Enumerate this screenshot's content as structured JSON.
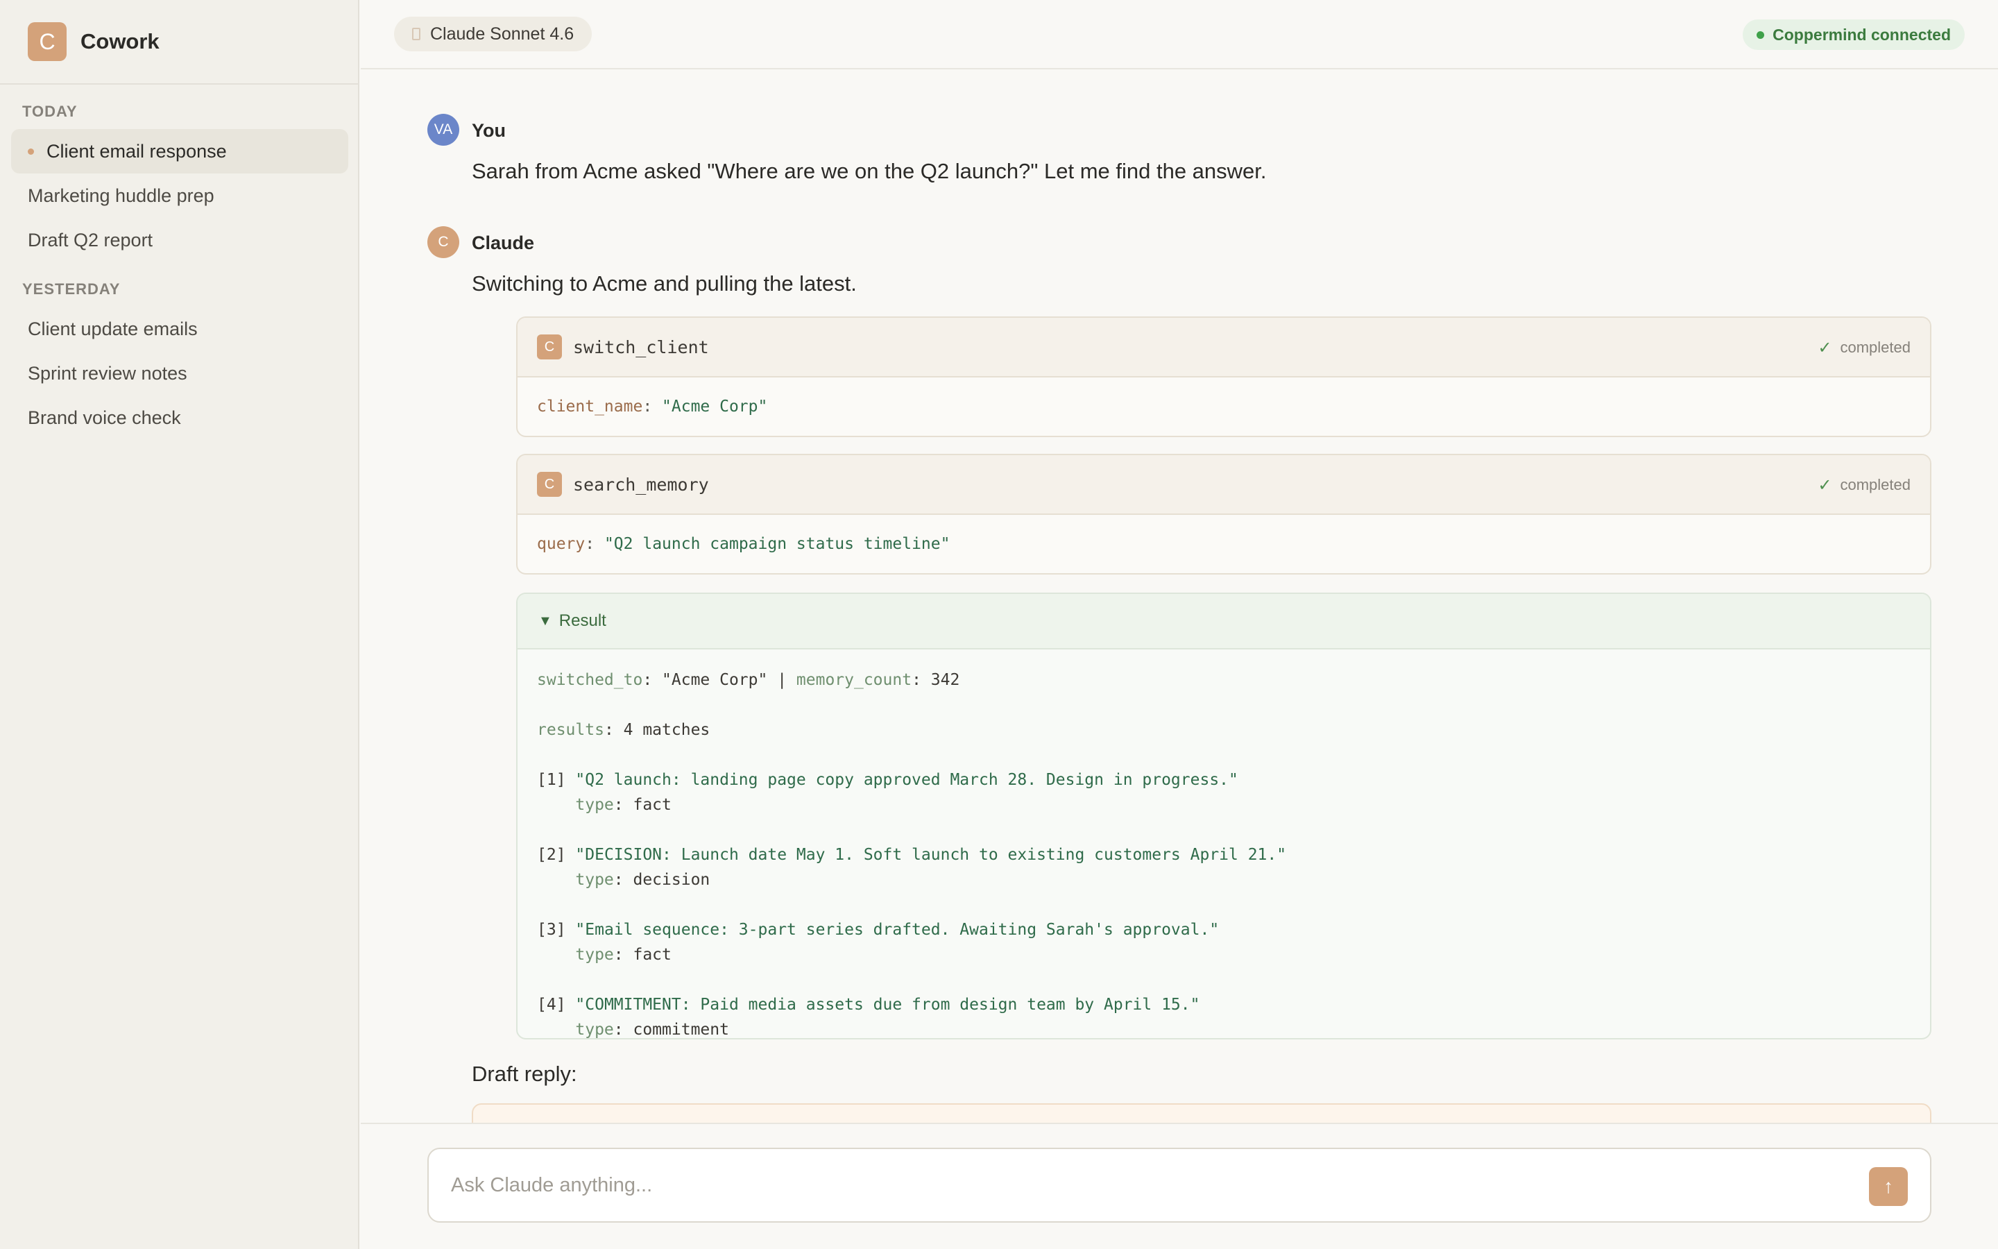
{
  "app": {
    "logo_letter": "C",
    "name": "Cowork"
  },
  "sidebar": {
    "today_label": "TODAY",
    "yesterday_label": "YESTERDAY",
    "today": [
      {
        "label": "Client email response",
        "active": true
      },
      {
        "label": "Marketing huddle prep"
      },
      {
        "label": "Draft Q2 report"
      }
    ],
    "yesterday": [
      {
        "label": "Client update emails"
      },
      {
        "label": "Sprint review notes"
      },
      {
        "label": "Brand voice check"
      }
    ]
  },
  "header": {
    "model": "Claude Sonnet 4.6",
    "status": "Coppermind connected",
    "status_color": "#3fa14a"
  },
  "messages": {
    "user": {
      "avatar": "VA",
      "avatar_color": "#6b86c9",
      "author": "You",
      "text": "Sarah from Acme asked \"Where are we on the Q2 launch?\" Let me find the answer."
    },
    "assistant": {
      "avatar": "C",
      "avatar_color": "#d4a27a",
      "author": "Claude",
      "intro": "Switching to Acme and pulling the latest.",
      "draft_label": "Draft reply:"
    }
  },
  "tools": [
    {
      "icon": "C",
      "name": "switch_client",
      "status": "completed",
      "arg_key": "client_name",
      "arg_value": "\"Acme Corp\""
    },
    {
      "icon": "C",
      "name": "search_memory",
      "status": "completed",
      "arg_key": "query",
      "arg_value": "\"Q2 launch campaign status timeline\""
    }
  ],
  "result": {
    "toggle": "▼",
    "label": "Result",
    "switched_to_key": "switched_to",
    "switched_to_value": "\"Acme Corp\"",
    "separator": " | ",
    "memory_count_key": "memory_count",
    "memory_count_value": "342",
    "results_key": "results",
    "results_value": "4 matches",
    "type_key": "type",
    "items": [
      {
        "index": "[1]",
        "text": "\"Q2 launch: landing page copy approved March 28. Design in progress.\"",
        "type": "fact"
      },
      {
        "index": "[2]",
        "text": "\"DECISION: Launch date May 1. Soft launch to existing customers April 21.\"",
        "type": "decision"
      },
      {
        "index": "[3]",
        "text": "\"Email sequence: 3-part series drafted. Awaiting Sarah's approval.\"",
        "type": "fact"
      },
      {
        "index": "[4]",
        "text": "\"COMMITMENT: Paid media assets due from design team by April 15.\"",
        "type": "commitment"
      }
    ]
  },
  "composer": {
    "placeholder": "Ask Claude anything...",
    "send_icon": "↑"
  }
}
